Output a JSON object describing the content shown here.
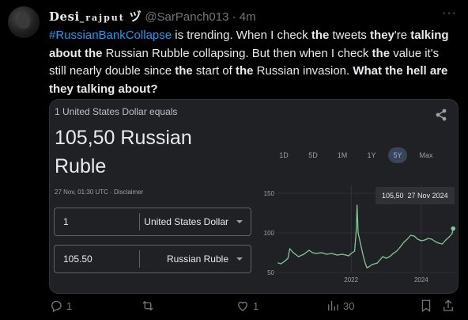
{
  "tweet": {
    "display_name": "Desi",
    "display_name_rest": "_rajput",
    "name_glyph": "ヅ",
    "handle": "@SarPanch013 · 4m",
    "text_runs": [
      {
        "t": "#RussianBankCollapse",
        "s": "tag"
      },
      {
        "t": "  is trending. When I check ",
        "s": ""
      },
      {
        "t": "the",
        "s": "b"
      },
      {
        "t": " tweets ",
        "s": ""
      },
      {
        "t": "they",
        "s": "b"
      },
      {
        "t": "'re ",
        "s": ""
      },
      {
        "t": "talking about the",
        "s": "b"
      },
      {
        "t": " Russian Rubble collapsing. But then when I check ",
        "s": ""
      },
      {
        "t": "the",
        "s": "b"
      },
      {
        "t": " value it's still nearly double since ",
        "s": ""
      },
      {
        "t": "the",
        "s": "b"
      },
      {
        "t": " start of ",
        "s": ""
      },
      {
        "t": "the",
        "s": "b"
      },
      {
        "t": " Russian invasion. ",
        "s": ""
      },
      {
        "t": "What the hell are they talking about?",
        "s": "b"
      }
    ]
  },
  "card": {
    "equals_text": "1 United States Dollar equals",
    "amount": "105,50 Russian Ruble",
    "meta": "27 Nov, 01:30 UTC · Disclaimer",
    "from_value": "1",
    "from_currency": "United States Dollar",
    "to_value": "105.50",
    "to_currency": "Russian Ruble",
    "tabs": [
      "1D",
      "5D",
      "1M",
      "1Y",
      "5Y",
      "Max"
    ],
    "active_tab": "5Y",
    "tooltip_value": "105,50",
    "tooltip_date": "27 Nov 2024"
  },
  "chart_data": {
    "type": "line",
    "title": "",
    "xlabel": "",
    "ylabel": "",
    "x_ticks": [
      "2022",
      "2024"
    ],
    "y_ticks": [
      50,
      100,
      150
    ],
    "ylim": [
      50,
      160
    ],
    "xlim": [
      2019.9,
      2024.95
    ],
    "grid": true,
    "color": "#81c995",
    "series": [
      {
        "x": [
          2019.92,
          2020.0,
          2020.1,
          2020.2,
          2020.25,
          2020.35,
          2020.5,
          2020.65,
          2020.8,
          2020.9,
          2021.0,
          2021.15,
          2021.3,
          2021.45,
          2021.6,
          2021.75,
          2021.85,
          2021.93,
          2022.0,
          2022.1,
          2022.15,
          2022.17,
          2022.2,
          2022.28,
          2022.35,
          2022.4,
          2022.45,
          2022.5,
          2022.6,
          2022.75,
          2022.9,
          2023.0,
          2023.1,
          2023.2,
          2023.3,
          2023.4,
          2023.5,
          2023.6,
          2023.7,
          2023.8,
          2023.9,
          2024.0,
          2024.1,
          2024.2,
          2024.3,
          2024.4,
          2024.5,
          2024.6,
          2024.7,
          2024.8,
          2024.88,
          2024.91
        ],
        "y": [
          62,
          61,
          64,
          68,
          80,
          75,
          70,
          73,
          78,
          75,
          74,
          75,
          73,
          74,
          72,
          73,
          72,
          71,
          74,
          77,
          105,
          135,
          100,
          84,
          70,
          62,
          56,
          57,
          60,
          62,
          70,
          68,
          70,
          74,
          77,
          82,
          88,
          92,
          97,
          96,
          92,
          90,
          91,
          93,
          92,
          89,
          87,
          86,
          91,
          95,
          99,
          105.5
        ]
      }
    ]
  },
  "actions": {
    "reply_count": "1",
    "retweet_count": "",
    "like_count": "1",
    "view_count": "30"
  },
  "colors": {
    "accent": "#1d9bf0",
    "muted": "#71767b",
    "line": "#81c995"
  }
}
